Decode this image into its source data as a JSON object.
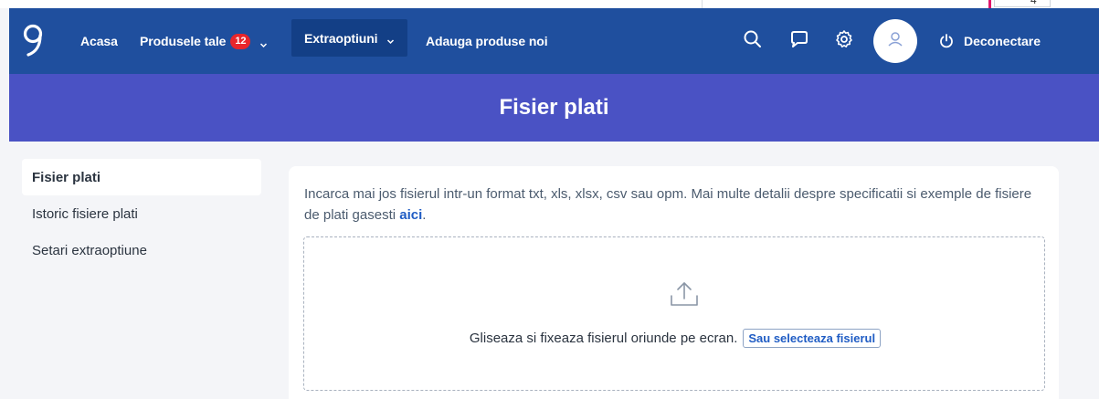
{
  "nav": {
    "home_label": "Acasa",
    "products_label": "Produsele tale",
    "products_badge": "12",
    "extra_label": "Extraoptiuni",
    "add_products_label": "Adauga produse noi",
    "logout_label": "Deconectare"
  },
  "topstrip": {
    "peek_glyph": "4"
  },
  "banner": {
    "title": "Fisier plati"
  },
  "sidebar": {
    "items": [
      {
        "label": "Fisier plati",
        "active": true
      },
      {
        "label": "Istoric fisiere plati",
        "active": false
      },
      {
        "label": "Setari extraoptiune",
        "active": false
      }
    ]
  },
  "content": {
    "description": "Incarca mai jos fisierul intr-un format txt, xls, xlsx, csv sau opm. Mai multe detalii despre specificatii si exemple de fisiere de plati gasesti ",
    "link_label": "aici",
    "description_end": ".",
    "drop_text": "Gliseaza si fixeaza fisierul oriunde pe ecran.",
    "select_button": "Sau selecteaza fisierul"
  },
  "icons": {
    "logo": "brand-logo-icon",
    "search": "search-icon",
    "messages": "chat-bubble-icon",
    "settings": "gear-icon",
    "avatar": "user-icon",
    "logout": "power-icon",
    "upload": "upload-icon"
  },
  "colors": {
    "navbar": "#1f4f9e",
    "navbar_active": "#133f86",
    "banner": "#4a52c4",
    "badge": "#e8262b",
    "link": "#1f5cc4",
    "page_bg": "#f4f5f8"
  }
}
